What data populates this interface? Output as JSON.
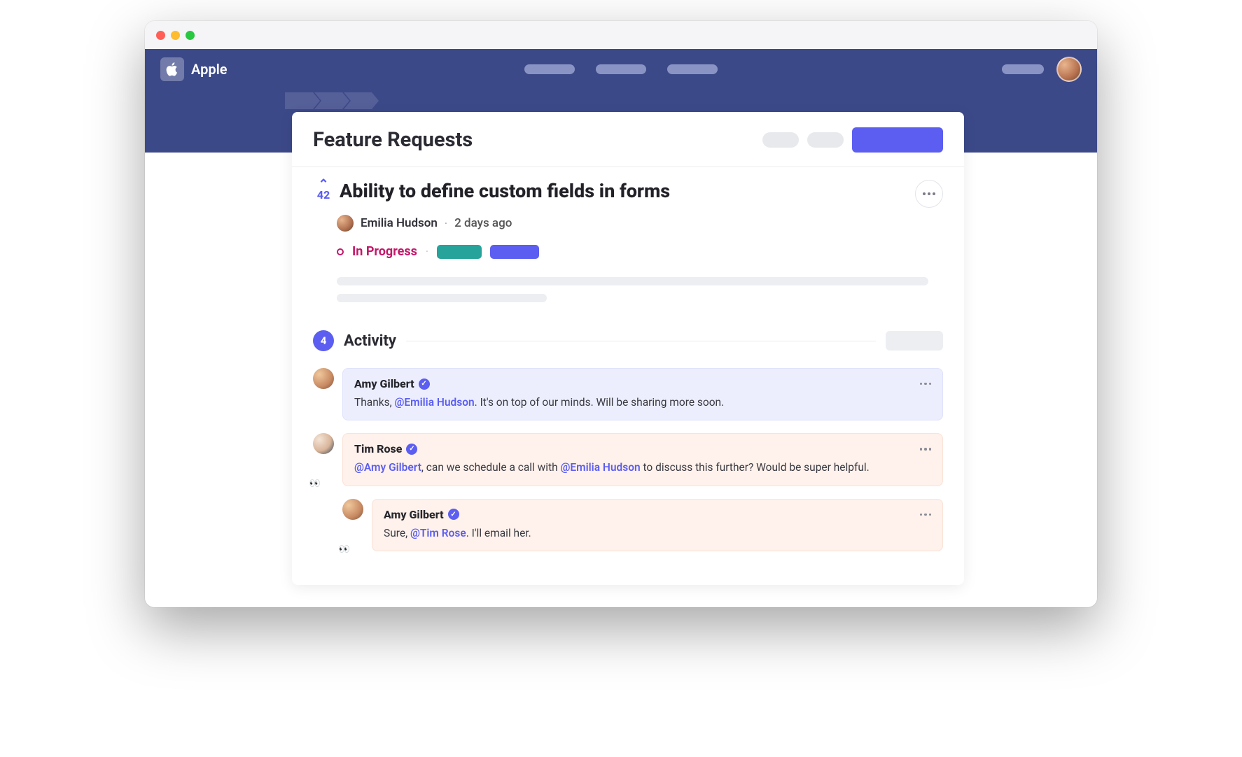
{
  "org": {
    "name": "Apple"
  },
  "section": {
    "title": "Feature Requests"
  },
  "post": {
    "title": "Ability to define custom fields in forms",
    "votes": "42",
    "author": "Emilia Hudson",
    "time": "2 days ago",
    "status": "In Progress"
  },
  "activity": {
    "count": "4",
    "label": "Activity"
  },
  "comments": [
    {
      "author": "Amy Gilbert",
      "text_pre": "Thanks, ",
      "mention1": "@Emilia Hudson",
      "text_post": ". It's on top of our minds. Will be sharing more soon.",
      "bubble": "lav",
      "avatar": "amy",
      "eyes": false
    },
    {
      "author": "Tim Rose",
      "mention1": "@Amy Gilbert",
      "text_mid1": ", can we schedule a call with ",
      "mention2": "@Emilia Hudson",
      "text_post": " to discuss this further? Would be super helpful.",
      "bubble": "peach",
      "avatar": "tim",
      "eyes": true
    },
    {
      "author": "Amy Gilbert",
      "text_pre": "Sure, ",
      "mention1": "@Tim Rose",
      "text_post": ". I'll email her.",
      "bubble": "peach",
      "avatar": "amy",
      "eyes": true,
      "indent": true
    }
  ]
}
